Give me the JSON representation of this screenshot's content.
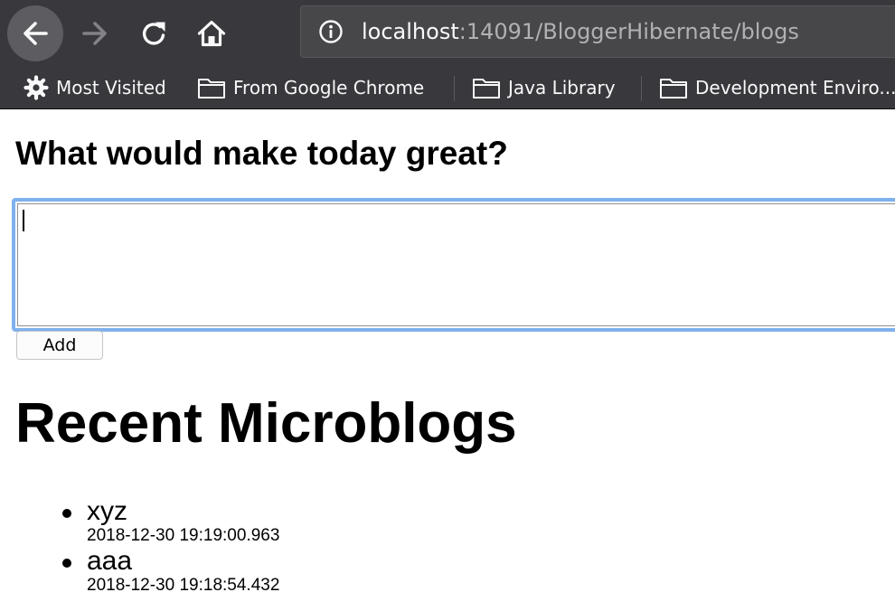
{
  "browser": {
    "url_host": "localhost",
    "url_rest": ":14091/BloggerHibernate/blogs",
    "nav_icons": [
      "back-arrow-icon",
      "forward-arrow-icon",
      "reload-icon",
      "home-icon",
      "info-icon"
    ]
  },
  "bookmarks": [
    {
      "label": "Most Visited",
      "icon": "gear-icon"
    },
    {
      "label": "From Google Chrome",
      "icon": "folder-icon"
    },
    {
      "label": "Java Library",
      "icon": "folder-icon"
    },
    {
      "label": "Development Enviro...",
      "icon": "folder-icon"
    }
  ],
  "page": {
    "prompt": "What would make today great?",
    "entry_value": "",
    "add_label": "Add",
    "heading": "Recent Microblogs",
    "blogs": [
      {
        "text": "xyz",
        "time": "2018-12-30 19:19:00.963"
      },
      {
        "text": "aaa",
        "time": "2018-12-30 19:18:54.432"
      }
    ]
  },
  "colors": {
    "chrome": "#38383d",
    "urlbar": "#474749",
    "focus_ring": "#7fb1ee"
  }
}
